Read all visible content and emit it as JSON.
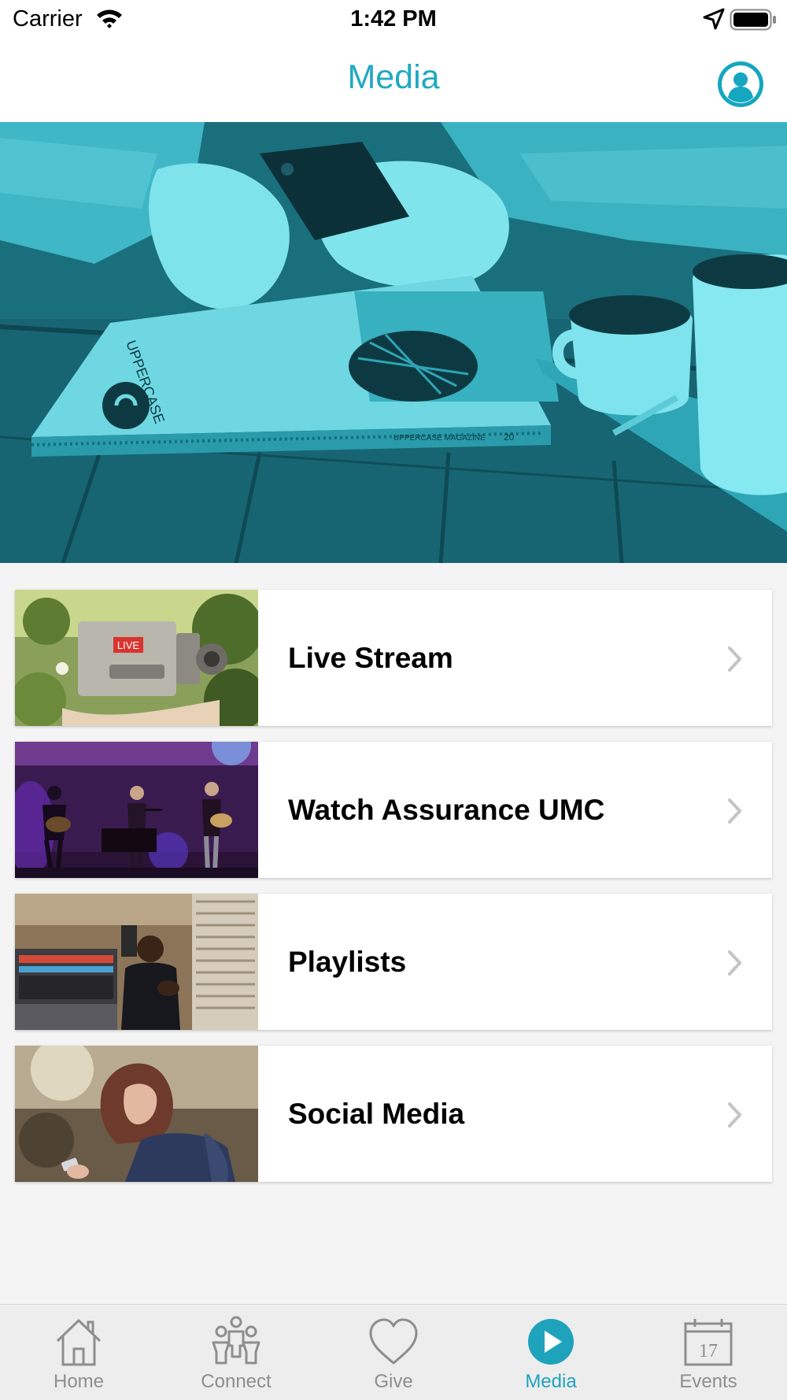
{
  "status_bar": {
    "carrier": "Carrier",
    "time": "1:42 PM"
  },
  "nav": {
    "title": "Media"
  },
  "media_items": [
    {
      "label": "Live Stream",
      "thumb_badge": "LIVE"
    },
    {
      "label": "Watch Assurance UMC"
    },
    {
      "label": "Playlists"
    },
    {
      "label": "Social Media"
    }
  ],
  "hero": {
    "magazine_spine": "UPPERCASE MAGAZINE",
    "magazine_cover": "UPPERCASE",
    "magazine_issue": "20"
  },
  "tab_bar": {
    "tabs": [
      {
        "label": "Home",
        "icon": "house-icon"
      },
      {
        "label": "Connect",
        "icon": "people-icon"
      },
      {
        "label": "Give",
        "icon": "heart-icon"
      },
      {
        "label": "Media",
        "icon": "play-circle-icon",
        "active": true
      },
      {
        "label": "Events",
        "icon": "calendar-icon",
        "calendar_day": "17"
      }
    ]
  },
  "colors": {
    "accent": "#1fa9c2",
    "tab_inactive": "#8e8e8e",
    "background": "#f4f4f4"
  }
}
